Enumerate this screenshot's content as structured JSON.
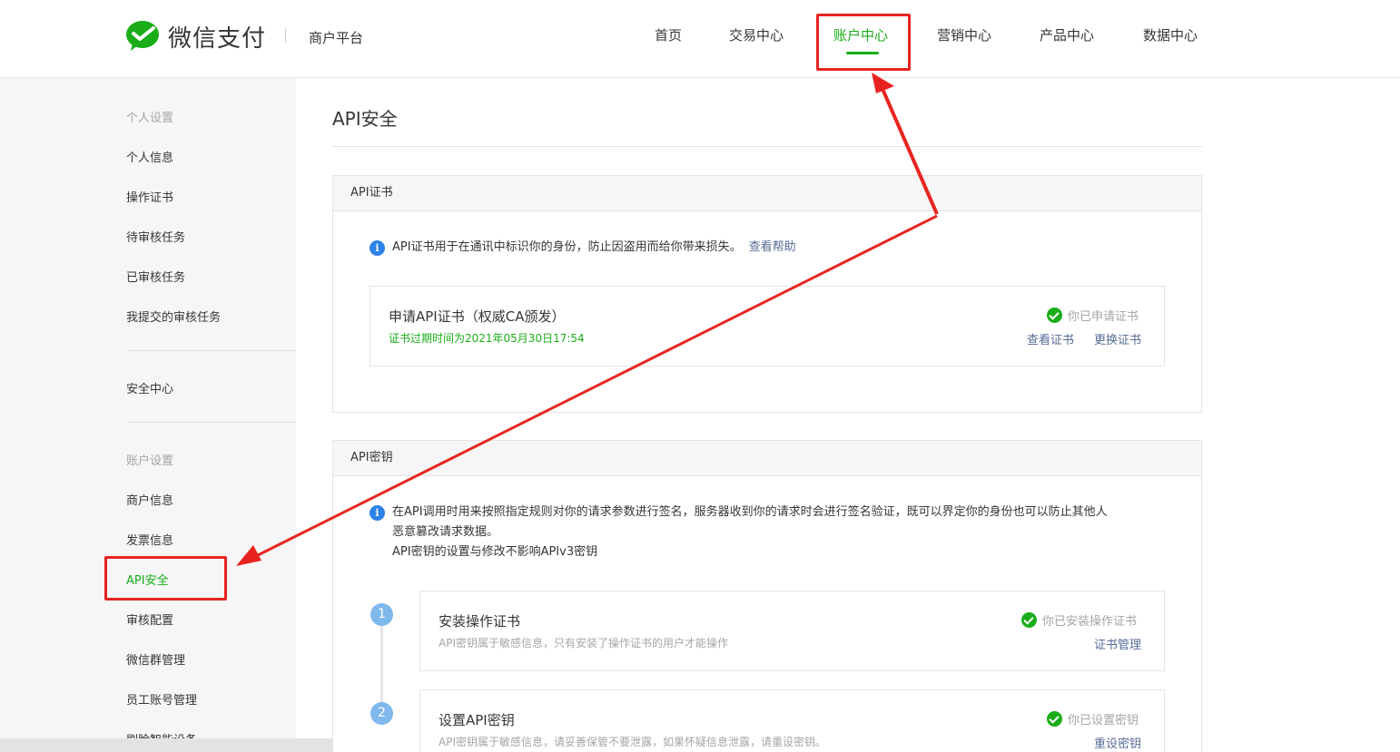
{
  "brand": {
    "logo_text": "微信支付",
    "platform": "商户平台"
  },
  "nav": {
    "items": [
      {
        "label": "首页"
      },
      {
        "label": "交易中心"
      },
      {
        "label": "账户中心"
      },
      {
        "label": "营销中心"
      },
      {
        "label": "产品中心"
      },
      {
        "label": "数据中心"
      }
    ],
    "active": "账户中心"
  },
  "sidebar": {
    "personal_group": "个人设置",
    "personal_items": [
      "个人信息",
      "操作证书",
      "待审核任务",
      "已审核任务",
      "我提交的审核任务"
    ],
    "security_center": "安全中心",
    "account_group": "账户设置",
    "account_items": [
      "商户信息",
      "发票信息",
      "API安全",
      "审核配置",
      "微信群管理",
      "员工账号管理",
      "刷脸智能设备"
    ],
    "active": "API安全"
  },
  "main": {
    "title": "API安全",
    "cert_panel": {
      "heading": "API证书",
      "info": "API证书用于在通讯中标识你的身份，防止因盗用而给你带来损失。",
      "help_link": "查看帮助",
      "card": {
        "title": "申请API证书（权威CA颁发）",
        "expiry": "证书过期时间为2021年05月30日17:54",
        "status": "你已申请证书",
        "view": "查看证书",
        "replace": "更换证书"
      }
    },
    "key_panel": {
      "heading": "API密钥",
      "info_line1": "在API调用时用来按照指定规则对你的请求参数进行签名，服务器收到你的请求时会进行签名验证，既可以界定你的身份也可以防止其他人",
      "info_line2": "恶意篡改请求数据。",
      "info_line3": "API密钥的设置与修改不影响APIv3密钥",
      "steps": [
        {
          "number": "1",
          "title": "安装操作证书",
          "desc": "API密钥属于敏感信息，只有安装了操作证书的用户才能操作",
          "status": "你已安装操作证书",
          "action": "证书管理"
        },
        {
          "number": "2",
          "title": "设置API密钥",
          "desc": "API密钥属于敏感信息，请妥善保管不要泄露，如果怀疑信息泄露，请重设密钥。",
          "status": "你已设置密钥",
          "action": "重设密钥"
        }
      ]
    }
  },
  "colors": {
    "accent_green": "#1aad19",
    "link_blue": "#576b95",
    "info_blue": "#2c82e6",
    "annotation_red": "#e8231f"
  }
}
